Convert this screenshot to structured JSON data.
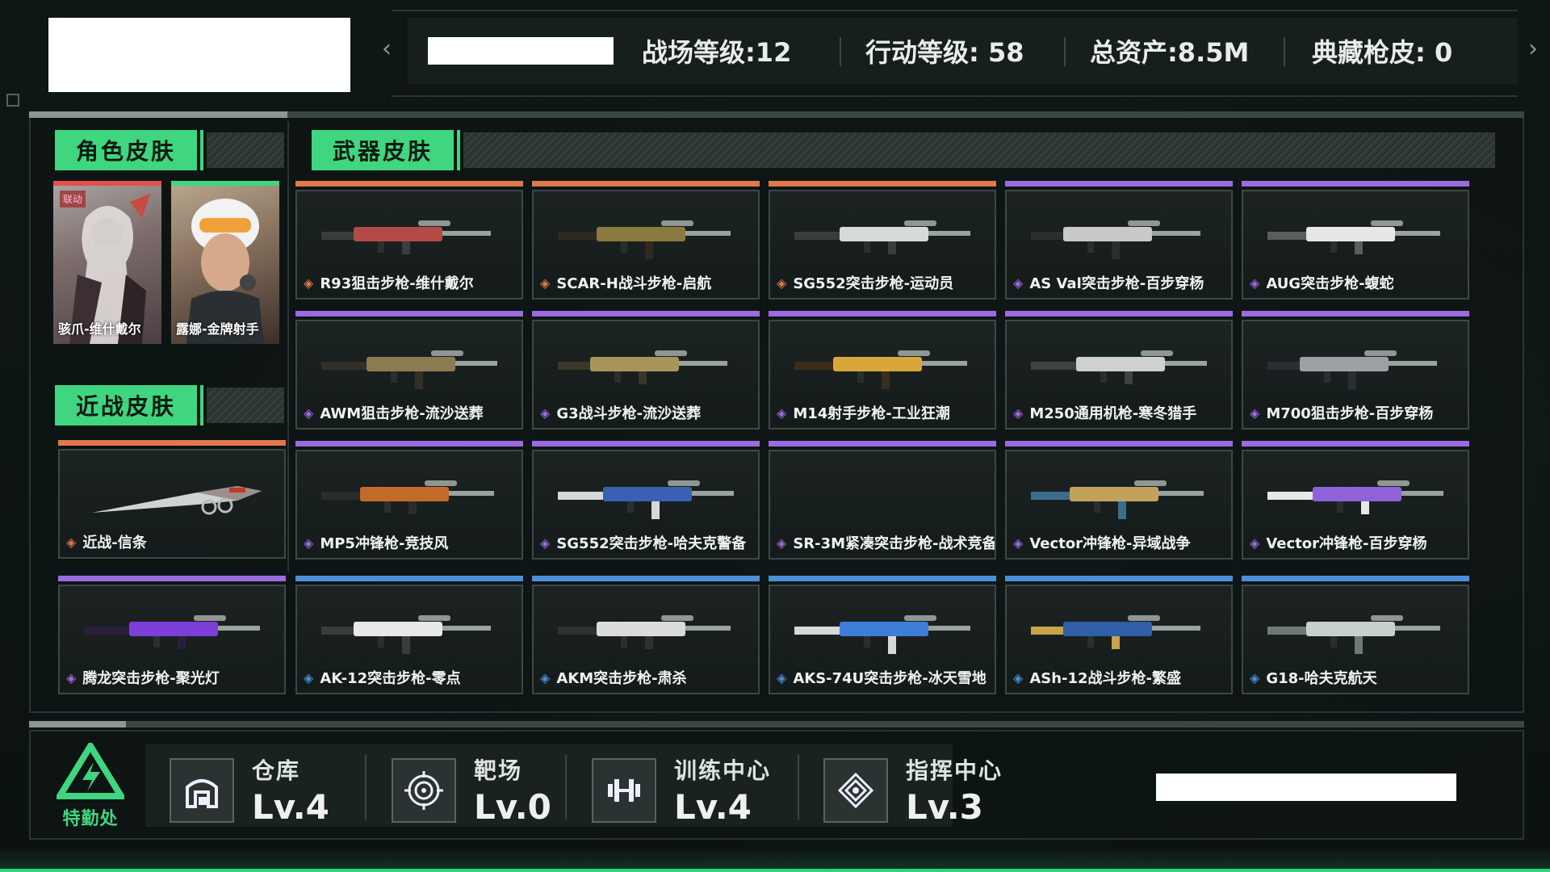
{
  "header": {
    "stats": [
      {
        "label": "战场等级:12"
      },
      {
        "label": "行动等级: 58"
      },
      {
        "label": "总资产:8.5M"
      },
      {
        "label": "典藏枪皮: 0"
      }
    ],
    "prev_arrow": "‹",
    "next_arrow": "›"
  },
  "character_section": {
    "title": "角色皮肤",
    "items": [
      {
        "name": "骇爪-维什戴尔",
        "tag": "联动",
        "rarity_color": "#e0504a"
      },
      {
        "name": "露娜-金牌射手",
        "rarity_color": "#3fd67f"
      }
    ]
  },
  "melee_section": {
    "title": "近战皮肤",
    "items": [
      {
        "name": "近战-信条",
        "rarity_color": "#e0784a"
      }
    ]
  },
  "weapon_section": {
    "title": "武器皮肤",
    "items": [
      {
        "name": "R93狙击步枪-维什戴尔",
        "rarity": "orange"
      },
      {
        "name": "SCAR-H战斗步枪-启航",
        "rarity": "orange"
      },
      {
        "name": "SG552突击步枪-运动员",
        "rarity": "orange"
      },
      {
        "name": "AS Val突击步枪-百步穿杨",
        "rarity": "purple"
      },
      {
        "name": "AUG突击步枪-蝮蛇",
        "rarity": "purple"
      },
      {
        "name": "AWM狙击步枪-流沙送葬",
        "rarity": "purple"
      },
      {
        "name": "G3战斗步枪-流沙送葬",
        "rarity": "purple"
      },
      {
        "name": "M14射手步枪-工业狂潮",
        "rarity": "purple"
      },
      {
        "name": "M250通用机枪-寒冬猎手",
        "rarity": "purple"
      },
      {
        "name": "M700狙击步枪-百步穿杨",
        "rarity": "purple"
      },
      {
        "name": "MP5冲锋枪-竞技风",
        "rarity": "purple"
      },
      {
        "name": "SG552突击步枪-哈夫克警备",
        "rarity": "purple"
      },
      {
        "name": "SR-3M紧凑突击步枪-战术竞备",
        "rarity": "purple"
      },
      {
        "name": "Vector冲锋枪-异域战争",
        "rarity": "purple"
      },
      {
        "name": "Vector冲锋枪-百步穿杨",
        "rarity": "purple"
      }
    ]
  },
  "bottom_row_weapons": [
    {
      "name": "腾龙突击步枪-聚光灯",
      "rarity": "purple"
    },
    {
      "name": "AK-12突击步枪-零点",
      "rarity": "blue"
    },
    {
      "name": "AKM突击步枪-肃杀",
      "rarity": "blue"
    },
    {
      "name": "AKS-74U突击步枪-冰天雪地",
      "rarity": "blue"
    },
    {
      "name": "ASh-12战斗步枪-繁盛",
      "rarity": "blue"
    },
    {
      "name": "G18-哈夫克航天",
      "rarity": "blue"
    }
  ],
  "colors": {
    "orange": "#e0784a",
    "purple": "#9b6ae0",
    "blue": "#4a8fd8",
    "accent": "#3fd67f"
  },
  "footer": {
    "logo_text": "特勤处",
    "facilities": [
      {
        "name": "仓库",
        "level": "Lv.4",
        "icon": "warehouse-icon"
      },
      {
        "name": "靶场",
        "level": "Lv.0",
        "icon": "target-icon"
      },
      {
        "name": "训练中心",
        "level": "Lv.4",
        "icon": "dumbbell-icon"
      },
      {
        "name": "指挥中心",
        "level": "Lv.3",
        "icon": "command-icon"
      }
    ]
  }
}
